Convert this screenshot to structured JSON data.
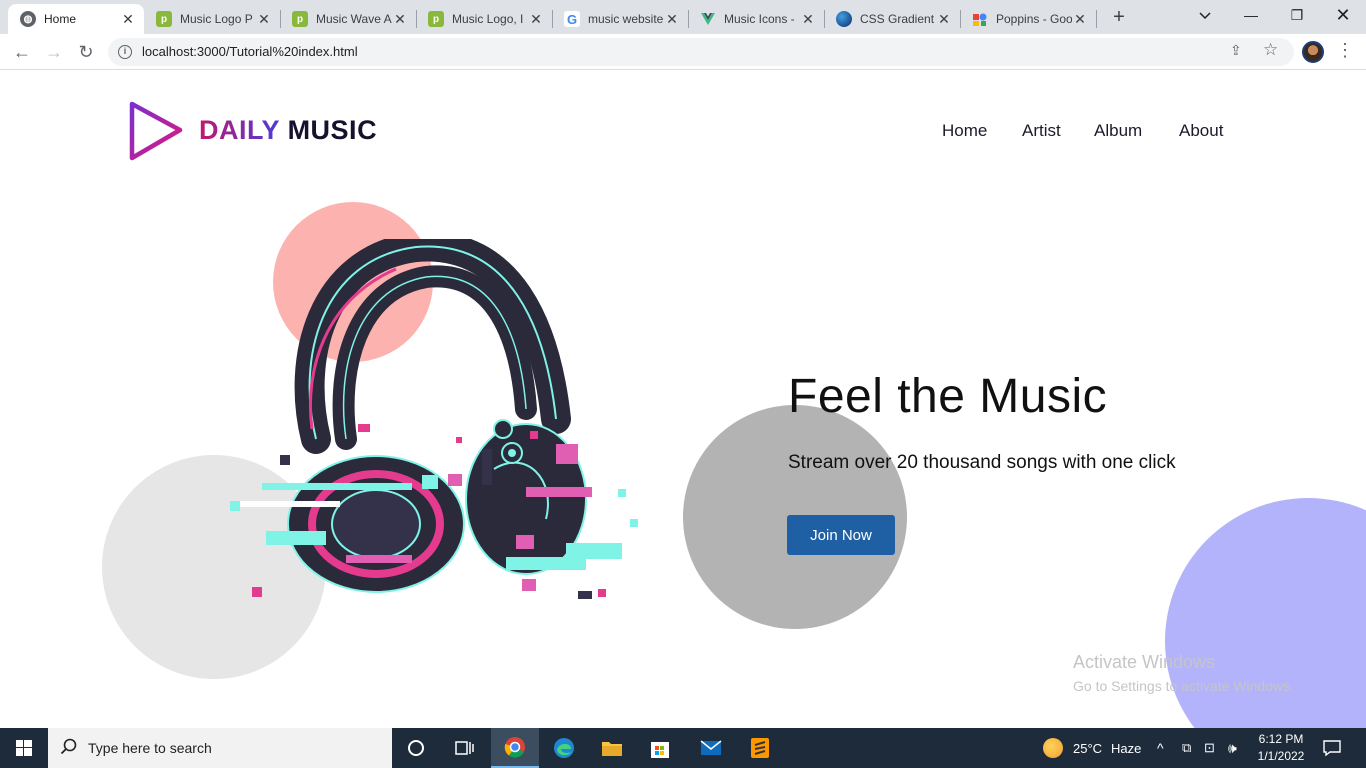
{
  "browser": {
    "tabs": [
      {
        "title": "Home",
        "icon": "globe-icon",
        "active": true
      },
      {
        "title": "Music Logo P",
        "icon": "freepik-icon"
      },
      {
        "title": "Music Wave A",
        "icon": "freepik-icon"
      },
      {
        "title": "Music Logo, I",
        "icon": "freepik-icon"
      },
      {
        "title": "music website",
        "icon": "google-icon"
      },
      {
        "title": "Music Icons -",
        "icon": "vuejs-icon"
      },
      {
        "title": "CSS Gradient",
        "icon": "css-gradient-icon"
      },
      {
        "title": "Poppins - Goo",
        "icon": "google-fonts-icon"
      }
    ],
    "url": "localhost:3000/Tutorial%20index.html"
  },
  "page": {
    "logo": {
      "word1": "DAILY",
      "word2": "MUSIC"
    },
    "nav": [
      "Home",
      "Artist",
      "Album",
      "About"
    ],
    "hero": {
      "title": "Feel the Music",
      "subtitle": "Stream over 20 thousand songs with one click",
      "cta": "Join Now"
    },
    "watermark": {
      "line1": "Activate Windows",
      "line2": "Go to Settings to activate Windows."
    }
  },
  "taskbar": {
    "search_placeholder": "Type here to search",
    "weather": {
      "temp": "25°C",
      "condition": "Haze"
    },
    "time": "6:12 PM",
    "date": "1/1/2022"
  },
  "colors": {
    "pink_circle": "#fcb3b0",
    "purple_circle": "#b3b3fb",
    "button": "#1f5fa4",
    "taskbar": "#1d2b3a"
  }
}
